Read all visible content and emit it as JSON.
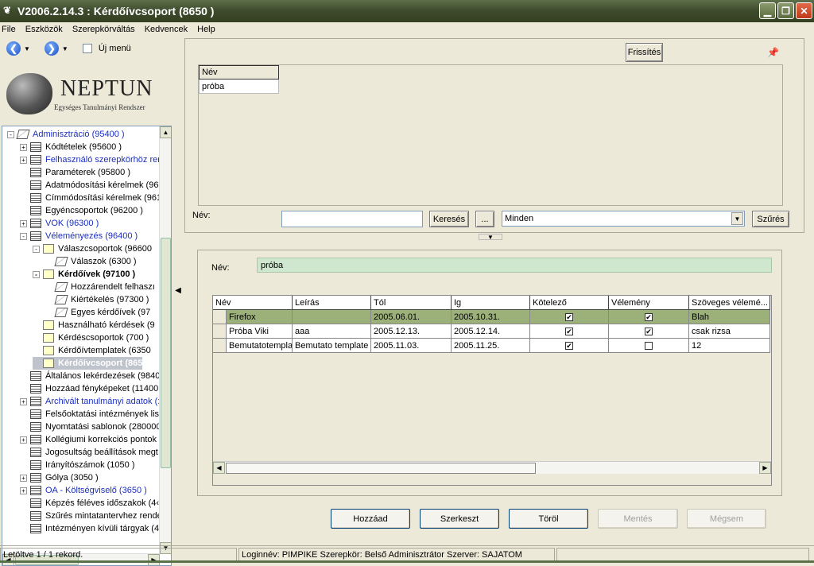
{
  "window": {
    "title": "V2006.2.14.3 : Kérdőívcsoport (8650  )"
  },
  "menu": [
    "File",
    "Eszközök",
    "Szerepkörváltás",
    "Kedvencek",
    "Help"
  ],
  "nav": {
    "new_menu_label": "Új menü"
  },
  "logo": {
    "title": "NEPTUN",
    "subtitle": "Egységes Tanulmányi Rendszer"
  },
  "tree": [
    {
      "label": "Adminisztráció (95400  )",
      "icon": "book-icon",
      "exp": "-",
      "blue": true
    },
    {
      "label": "Kódtételek (95600  )",
      "icon": "note-icon",
      "exp": "+"
    },
    {
      "label": "Felhasználó szerepkörhöz rer",
      "icon": "note-icon",
      "exp": "+",
      "blue": true
    },
    {
      "label": "Paraméterek (95800  )",
      "icon": "note-icon"
    },
    {
      "label": "Adatmódosítási kérelmek (96",
      "icon": "note-icon"
    },
    {
      "label": "Címmódosítási kérelmek (961",
      "icon": "note-icon"
    },
    {
      "label": "Egyéncsoportok (96200  )",
      "icon": "note-icon"
    },
    {
      "label": "VOK (96300  )",
      "icon": "note-icon",
      "exp": "+",
      "blue": true
    },
    {
      "label": "Véleményezés (96400  )",
      "icon": "note-icon",
      "exp": "-",
      "blue": true
    },
    {
      "label": "Válaszcsoportok (96600",
      "icon": "page-icon",
      "exp": "-"
    },
    {
      "label": "Válaszok (6300  )",
      "icon": "book-icon"
    },
    {
      "label": "Kérdőívek (97100  )",
      "icon": "page-icon",
      "exp": "-",
      "bold": true
    },
    {
      "label": "Hozzárendelt felhaszı",
      "icon": "book-icon"
    },
    {
      "label": "Kiértékelés (97300  )",
      "icon": "book-icon"
    },
    {
      "label": "Egyes kérdőívek (97",
      "icon": "book-icon"
    },
    {
      "label": "Használható kérdések (9",
      "icon": "page-icon"
    },
    {
      "label": "Kérdéscsoportok (700  )",
      "icon": "page-icon"
    },
    {
      "label": "Kérdőívtemplatek (6350",
      "icon": "page-icon"
    },
    {
      "label": "Kérdőívcsoport (865",
      "icon": "page-icon",
      "selected": true
    },
    {
      "label": "Általános lekérdezések (9840",
      "icon": "note-icon"
    },
    {
      "label": "Hozzáad fényképeket (11400",
      "icon": "note-icon"
    },
    {
      "label": "Archivált tanulmányi adatok (:",
      "icon": "note-icon",
      "exp": "+",
      "blue": true
    },
    {
      "label": "Felsőoktatási intézmények list",
      "icon": "note-icon"
    },
    {
      "label": "Nyomtatási sablonok (280000",
      "icon": "note-icon"
    },
    {
      "label": "Kollégiumi korrekciós pontok",
      "icon": "note-icon",
      "exp": "+"
    },
    {
      "label": "Jogosultság beállítások megt",
      "icon": "note-icon"
    },
    {
      "label": "Irányítószámok (1050  )",
      "icon": "note-icon"
    },
    {
      "label": "Gólya (3050  )",
      "icon": "note-icon",
      "exp": "+"
    },
    {
      "label": "OA - Költségviselő (3650  )",
      "icon": "note-icon",
      "exp": "+",
      "blue": true
    },
    {
      "label": "Képzés féléves időszakok (4‹",
      "icon": "note-icon"
    },
    {
      "label": "Szűrés mintatantervhez rende",
      "icon": "note-icon"
    },
    {
      "label": "Intézményen kívüli tárgyak (4",
      "icon": "note-icon"
    }
  ],
  "top": {
    "refresh_label": "Frissítés",
    "grid_header": "Név",
    "grid_rows": [
      "próba"
    ],
    "name_label": "Név:",
    "search_value": "",
    "search_label": "Keresés",
    "ellipsis_label": "...",
    "filter_value": "Minden",
    "filter_button": "Szűrés"
  },
  "detail": {
    "name_label": "Név:",
    "name_value": "próba",
    "columns": [
      "Név",
      "Leírás",
      "Tól",
      "Ig",
      "Kötelező",
      "Vélemény",
      "Szöveges vélemé..."
    ],
    "rows": [
      {
        "name": "Firefox",
        "desc": "",
        "from": "2005.06.01.",
        "to": "2005.10.31.",
        "mandatory": true,
        "opinion": true,
        "text": "Blah",
        "selected": true
      },
      {
        "name": "Próba Viki",
        "desc": "aaa",
        "from": "2005.12.13.",
        "to": "2005.12.14.",
        "mandatory": true,
        "opinion": true,
        "text": "csak rizsa"
      },
      {
        "name": "Bemutatotempla",
        "desc": "Bemutato template",
        "from": "2005.11.03.",
        "to": "2005.11.25.",
        "mandatory": true,
        "opinion": false,
        "text": "12"
      }
    ]
  },
  "buttons": {
    "add": "Hozzáad",
    "edit": "Szerkeszt",
    "delete": "Töröl",
    "save": "Mentés",
    "cancel": "Mégsem"
  },
  "status": {
    "records": "Letöltve 1 / 1 rekord.",
    "login": "Loginnév: PIMPIKE   Szerepkör: Belső Adminisztrátor   Szerver: SAJATOM"
  }
}
